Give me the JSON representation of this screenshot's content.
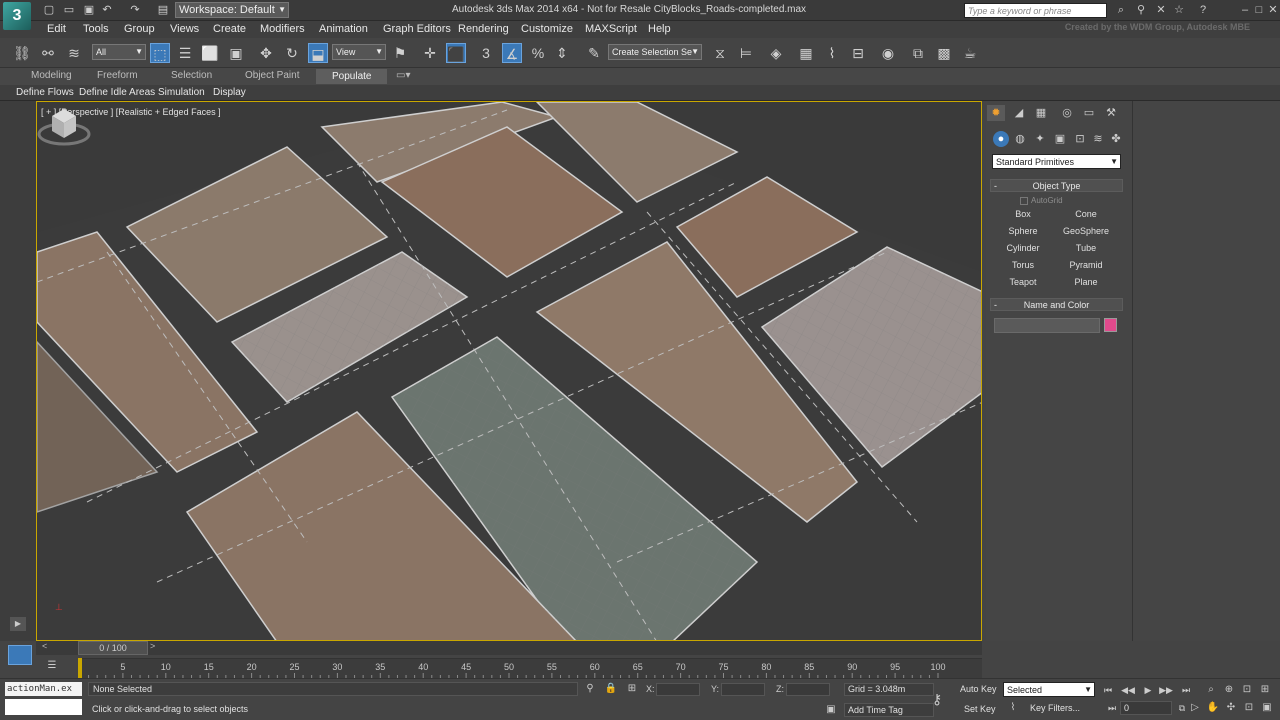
{
  "title_bar": {
    "logo": "3",
    "workspace": "Workspace: Default",
    "window_title": "Autodesk 3ds Max  2014 x64    -  Not for Resale    CityBlocks_Roads-completed.max",
    "search_placeholder": "Type a keyword or phrase"
  },
  "menu": {
    "items": [
      "Edit",
      "Tools",
      "Group",
      "Views",
      "Create",
      "Modifiers",
      "Animation",
      "Graph Editors",
      "Rendering",
      "Customize",
      "MAXScript",
      "Help"
    ],
    "credit": "Created by the WDM Group, Autodesk MBE"
  },
  "toolbar": {
    "selection_filter": "All",
    "ref_coord": "View",
    "named_selection": "Create Selection Se"
  },
  "ribbon": {
    "tabs": [
      "Modeling",
      "Freeform",
      "Selection",
      "Object Paint",
      "Populate"
    ],
    "active_tab": "Populate",
    "sub_items": [
      "Define Flows",
      "Define Idle Areas",
      "Simulation",
      "Display"
    ]
  },
  "viewport": {
    "label": "[ + ] [Perspective ] [Realistic + Edged Faces ]"
  },
  "command_panel": {
    "primitive_type": "Standard Primitives",
    "object_type_title": "Object Type",
    "autogrid": "AutoGrid",
    "buttons": [
      "Box",
      "Cone",
      "Sphere",
      "GeoSphere",
      "Cylinder",
      "Tube",
      "Torus",
      "Pyramid",
      "Teapot",
      "Plane"
    ],
    "name_color_title": "Name and Color",
    "color": "#e04a8c"
  },
  "timeline": {
    "frame_display": "0 / 100",
    "left_arrow": "<",
    "right_arrow": ">",
    "ticks": [
      0,
      5,
      10,
      15,
      20,
      25,
      30,
      35,
      40,
      45,
      50,
      55,
      60,
      65,
      70,
      75,
      80,
      85,
      90,
      95,
      100
    ],
    "tick_labels": [
      "5",
      "10",
      "15",
      "20",
      "25",
      "30",
      "35",
      "40",
      "45",
      "50",
      "55",
      "60",
      "65",
      "70",
      "75",
      "80",
      "85",
      "90",
      "95",
      "100"
    ]
  },
  "status": {
    "maxscript": "actionMan.ex",
    "selection": "None Selected",
    "prompt": "Click or click-and-drag to select objects",
    "x_label": "X:",
    "y_label": "Y:",
    "z_label": "Z:",
    "grid": "Grid = 3.048m",
    "add_time_tag": "Add Time Tag",
    "auto_key": "Auto Key",
    "set_key": "Set Key",
    "selected_set": "Selected",
    "key_filters": "Key Filters...",
    "current_frame": "0"
  }
}
